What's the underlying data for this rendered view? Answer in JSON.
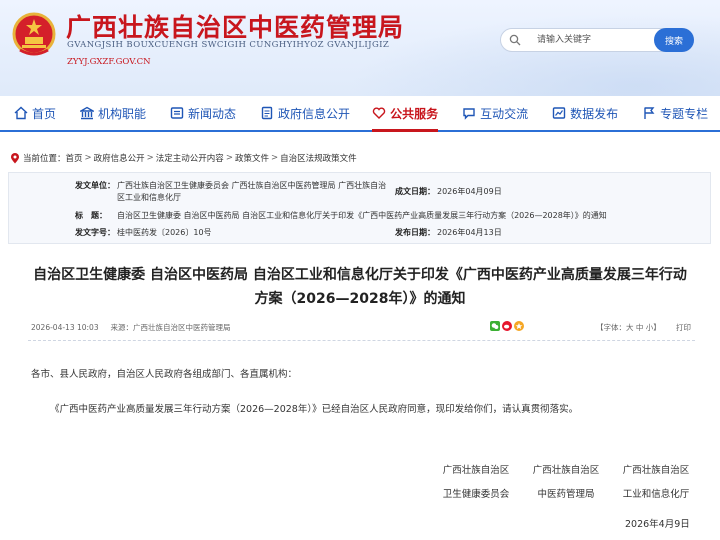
{
  "header": {
    "title": "广西壮族自治区中医药管理局",
    "subtitle": "GVANGJSIH BOUXCUENGH SWCIGIH CUNGHYIHYOZ GVANJLIJGIZ",
    "url": "ZYYJ.GXZF.GOV.CN",
    "search_placeholder": "请输入关键字",
    "search_button": "搜索"
  },
  "nav": [
    {
      "label": "首页",
      "icon": "home-icon"
    },
    {
      "label": "机构职能",
      "icon": "building-icon"
    },
    {
      "label": "新闻动态",
      "icon": "news-icon"
    },
    {
      "label": "政府信息公开",
      "icon": "document-icon"
    },
    {
      "label": "公共服务",
      "icon": "heart-icon",
      "active": true
    },
    {
      "label": "互动交流",
      "icon": "chat-icon"
    },
    {
      "label": "数据发布",
      "icon": "chart-icon"
    },
    {
      "label": "专题专栏",
      "icon": "flag-icon"
    }
  ],
  "breadcrumb": {
    "prefix": "当前位置：",
    "items": [
      "首页",
      "政府信息公开",
      "法定主动公开内容",
      "政策文件",
      "自治区法规政策文件"
    ]
  },
  "info": {
    "issuer_label": "发文单位：",
    "issuer_value": "广西壮族自治区卫生健康委员会 广西壮族自治区中医药管理局 广西壮族自治区工业和信息化厅",
    "date_label": "成文日期：",
    "date_value": "2026年04月09日",
    "title_label": "标　题：",
    "title_value": "自治区卫生健康委 自治区中医药局 自治区工业和信息化厅关于印发《广西中医药产业高质量发展三年行动方案（2026—2028年）》的通知",
    "docno_label": "发文字号：",
    "docno_value": "桂中医药发〔2026〕10号",
    "publish_label": "发布日期：",
    "publish_value": "2026年04月13日"
  },
  "article": {
    "title_line1": "自治区卫生健康委 自治区中医药局 自治区工业和信息化厅关于印发《广西中医药产业高质量发展三年行动",
    "title_line2": "方案（2026—2028年）》的通知",
    "meta_date": "2026-04-13 10:03",
    "meta_source": "来源：广西壮族自治区中医药管理局",
    "fontsize_label": "【字体：大 中 小】",
    "print_label": "打印",
    "salutation": "各市、县人民政府，自治区人民政府各组成部门、各直属机构：",
    "paragraph": "《广西中医药产业高质量发展三年行动方案（2026—2028年）》已经自治区人民政府同意，现印发给你们，请认真贯彻落实。",
    "signatures": [
      {
        "line1": "广西壮族自治区",
        "line2": "卫生健康委员会"
      },
      {
        "line1": "广西壮族自治区",
        "line2": "中医药管理局"
      },
      {
        "line1": "广西壮族自治区",
        "line2": "工业和信息化厅"
      }
    ],
    "sign_date": "2026年4月9日"
  },
  "colors": {
    "brand_red": "#c8161d",
    "nav_blue": "#1f56b6",
    "accent_blue": "#2b6fd6"
  }
}
